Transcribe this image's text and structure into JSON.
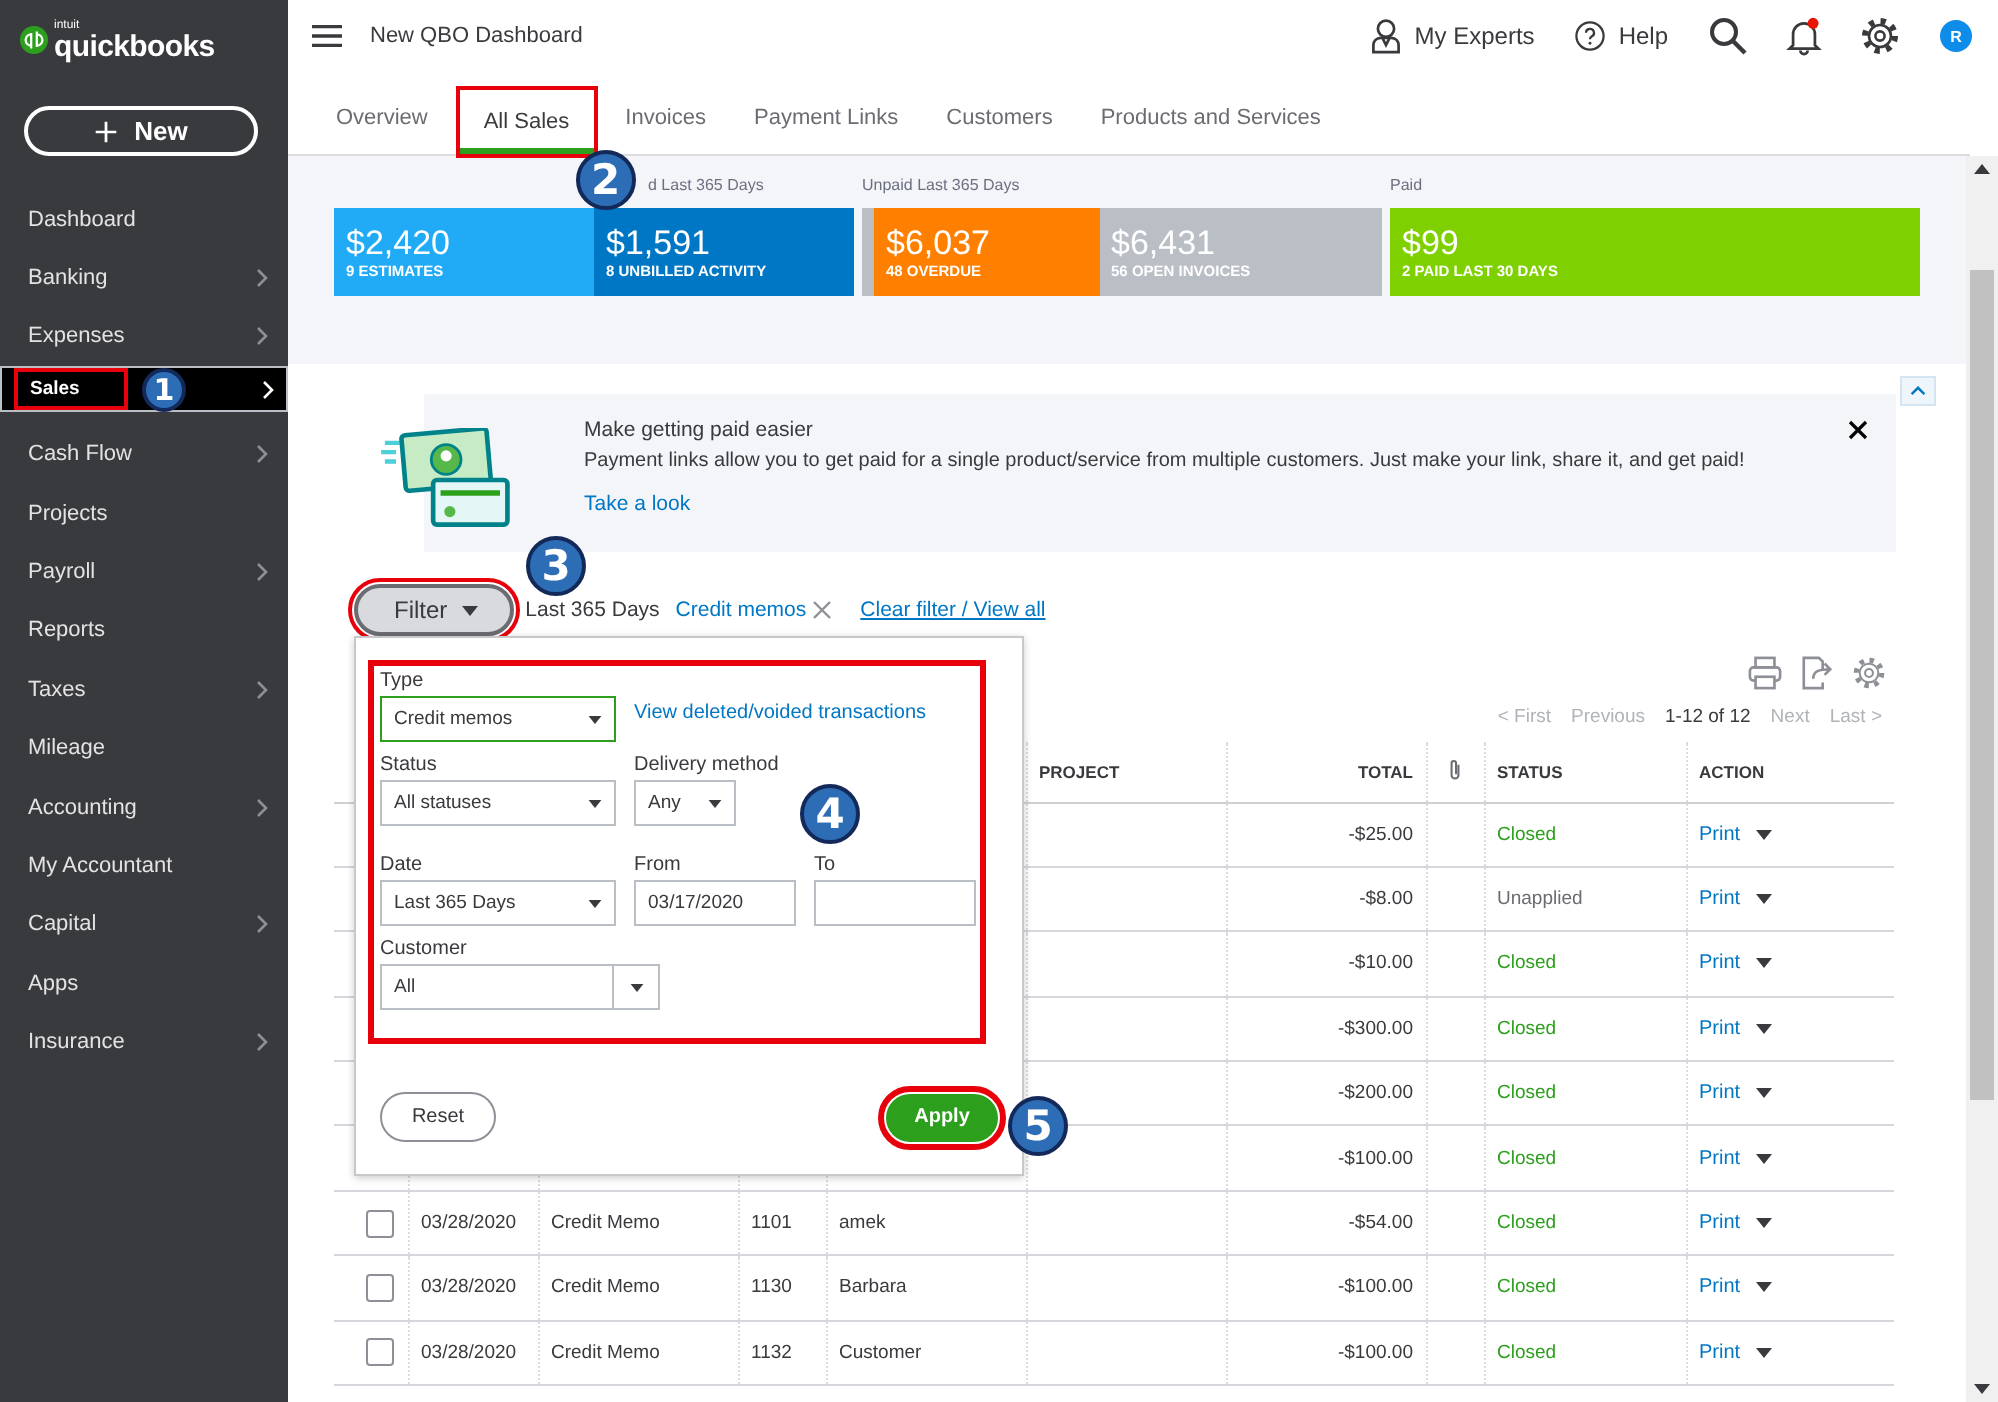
{
  "sidebar": {
    "logo": {
      "brand_small": "intuit",
      "brand": "quickbooks"
    },
    "new_button": "New",
    "items": [
      {
        "label": "Dashboard",
        "has_submenu": false,
        "selected": false,
        "highlighted": false
      },
      {
        "label": "Banking",
        "has_submenu": true,
        "selected": false,
        "highlighted": false
      },
      {
        "label": "Expenses",
        "has_submenu": true,
        "selected": false,
        "highlighted": false
      },
      {
        "label": "Sales",
        "has_submenu": true,
        "selected": true,
        "highlighted": true,
        "step": "1"
      },
      {
        "label": "Cash Flow",
        "has_submenu": true,
        "selected": false,
        "highlighted": false
      },
      {
        "label": "Projects",
        "has_submenu": false,
        "selected": false,
        "highlighted": false
      },
      {
        "label": "Payroll",
        "has_submenu": true,
        "selected": false,
        "highlighted": false
      },
      {
        "label": "Reports",
        "has_submenu": false,
        "selected": false,
        "highlighted": false
      },
      {
        "label": "Taxes",
        "has_submenu": true,
        "selected": false,
        "highlighted": false
      },
      {
        "label": "Mileage",
        "has_submenu": false,
        "selected": false,
        "highlighted": false
      },
      {
        "label": "Accounting",
        "has_submenu": true,
        "selected": false,
        "highlighted": false
      },
      {
        "label": "My Accountant",
        "has_submenu": false,
        "selected": false,
        "highlighted": false
      },
      {
        "label": "Capital",
        "has_submenu": true,
        "selected": false,
        "highlighted": false
      },
      {
        "label": "Apps",
        "has_submenu": false,
        "selected": false,
        "highlighted": false
      },
      {
        "label": "Insurance",
        "has_submenu": true,
        "selected": false,
        "highlighted": false
      }
    ]
  },
  "topbar": {
    "title": "New QBO Dashboard",
    "experts": "My Experts",
    "help": "Help",
    "has_notification": true,
    "avatar": "R"
  },
  "tabs": [
    {
      "label": "Overview",
      "selected": false,
      "highlighted": false
    },
    {
      "label": "All Sales",
      "selected": true,
      "highlighted": true,
      "step": "2"
    },
    {
      "label": "Invoices",
      "selected": false,
      "highlighted": false
    },
    {
      "label": "Payment Links",
      "selected": false,
      "highlighted": false
    },
    {
      "label": "Customers",
      "selected": false,
      "highlighted": false
    },
    {
      "label": "Products and Services",
      "selected": false,
      "highlighted": false
    }
  ],
  "summary": {
    "groups": [
      {
        "label": "d Last 365 Days",
        "cards": [
          {
            "kind": "card",
            "amount": "$2,420",
            "caption": "9 ESTIMATES",
            "color": "#21abf6"
          },
          {
            "kind": "card",
            "amount": "$1,591",
            "caption": "8 UNBILLED ACTIVITY",
            "color": "#0077c5"
          }
        ]
      },
      {
        "label": "Unpaid Last 365 Days",
        "cards": [
          {
            "kind": "segment",
            "color": "#babec5"
          },
          {
            "kind": "card",
            "amount": "$6,037",
            "caption": "48 OVERDUE",
            "color": "#ff8000"
          },
          {
            "kind": "card",
            "amount": "$6,431",
            "caption": "56 OPEN INVOICES",
            "color": "#babec5"
          }
        ]
      },
      {
        "label": "Paid",
        "cards": [
          {
            "kind": "card",
            "amount": "$99",
            "caption": "2 PAID LAST 30 DAYS",
            "color": "#7fd000"
          }
        ]
      }
    ]
  },
  "banner": {
    "title": "Make getting paid easier",
    "text": "Payment links allow you to get paid for a single product/service from multiple customers. Just make your link, share it, and get paid!",
    "link": "Take a look"
  },
  "filter": {
    "button": "Filter",
    "highlighted": true,
    "step": "3",
    "date_range": "Last 365 Days",
    "chips": [
      {
        "label": "Credit memos"
      }
    ],
    "clear": "Clear filter / View all"
  },
  "filter_panel": {
    "highlighted": true,
    "step": "4",
    "type_label": "Type",
    "type_value": "Credit memos",
    "type_focused": true,
    "deleted_link": "View deleted/voided transactions",
    "status_label": "Status",
    "status_value": "All statuses",
    "delivery_label": "Delivery method",
    "delivery_value": "Any",
    "date_label": "Date",
    "date_value": "Last 365 Days",
    "from_label": "From",
    "from_value": "03/17/2020",
    "to_label": "To",
    "customer_label": "Customer",
    "customer_value": "All",
    "reset": "Reset",
    "apply": {
      "label": "Apply",
      "highlighted": true,
      "step": "5"
    }
  },
  "pagination": [
    {
      "kind": "link",
      "label": "< First",
      "disabled": true
    },
    {
      "kind": "link",
      "label": "Previous",
      "disabled": true
    },
    {
      "kind": "range",
      "label": "1-12 of 12"
    },
    {
      "kind": "link",
      "label": "Next",
      "disabled": true
    },
    {
      "kind": "link",
      "label": "Last >",
      "disabled": true
    }
  ],
  "table": {
    "columns": [
      {
        "kind": "text",
        "label": "PROJECT"
      },
      {
        "kind": "text",
        "label": "TOTAL"
      },
      {
        "kind": "attachment"
      },
      {
        "kind": "text",
        "label": "STATUS"
      },
      {
        "kind": "text",
        "label": "ACTION"
      }
    ],
    "rows": [
      {
        "total": "-$25.00",
        "status": "Closed",
        "kind": "closed",
        "action": "Print"
      },
      {
        "total": "-$8.00",
        "status": "Unapplied",
        "kind": "unapplied",
        "action": "Print"
      },
      {
        "total": "-$10.00",
        "status": "Closed",
        "kind": "closed",
        "action": "Print"
      },
      {
        "total": "-$300.00",
        "status": "Closed",
        "kind": "closed",
        "action": "Print"
      },
      {
        "total": "-$200.00",
        "status": "Closed",
        "kind": "closed",
        "action": "Print"
      },
      {
        "total": "-$100.00",
        "status": "Closed",
        "kind": "closed",
        "action": "Print"
      },
      {
        "checked": false,
        "date": "03/28/2020",
        "type": "Credit Memo",
        "number": "1101",
        "customer": "amek",
        "total": "-$54.00",
        "status": "Closed",
        "kind": "closed",
        "action": "Print"
      },
      {
        "checked": false,
        "date": "03/28/2020",
        "type": "Credit Memo",
        "number": "1130",
        "customer": "Barbara",
        "total": "-$100.00",
        "status": "Closed",
        "kind": "closed",
        "action": "Print"
      },
      {
        "checked": false,
        "date": "03/28/2020",
        "type": "Credit Memo",
        "number": "1132",
        "customer": "Customer",
        "total": "-$100.00",
        "status": "Closed",
        "kind": "closed",
        "action": "Print"
      }
    ]
  }
}
